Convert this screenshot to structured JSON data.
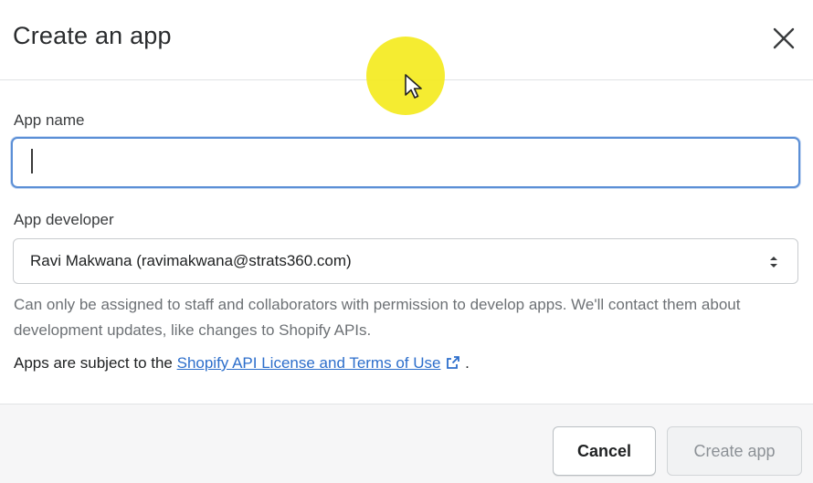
{
  "modal": {
    "title": "Create an app"
  },
  "form": {
    "app_name": {
      "label": "App name",
      "value": "",
      "placeholder": ""
    },
    "app_developer": {
      "label": "App developer",
      "selected": "Ravi Makwana (ravimakwana@strats360.com)",
      "help_text": "Can only be assigned to staff and collaborators with permission to develop apps. We'll contact them about development updates, like changes to Shopify APIs."
    },
    "terms": {
      "prefix": "Apps are subject to the ",
      "link_text": "Shopify API License and Terms of Use",
      "suffix": " ."
    }
  },
  "footer": {
    "cancel_label": "Cancel",
    "create_label": "Create app"
  },
  "icons": {
    "close": "close-icon",
    "select_arrows": "select-arrows-icon",
    "external_link": "external-link-icon",
    "pointer": "mouse-pointer-icon"
  },
  "colors": {
    "focus_border": "#5b8fd6",
    "link": "#2c6ecb",
    "cursor_highlight": "#f4ea1f",
    "disabled_text": "#8c9196"
  }
}
